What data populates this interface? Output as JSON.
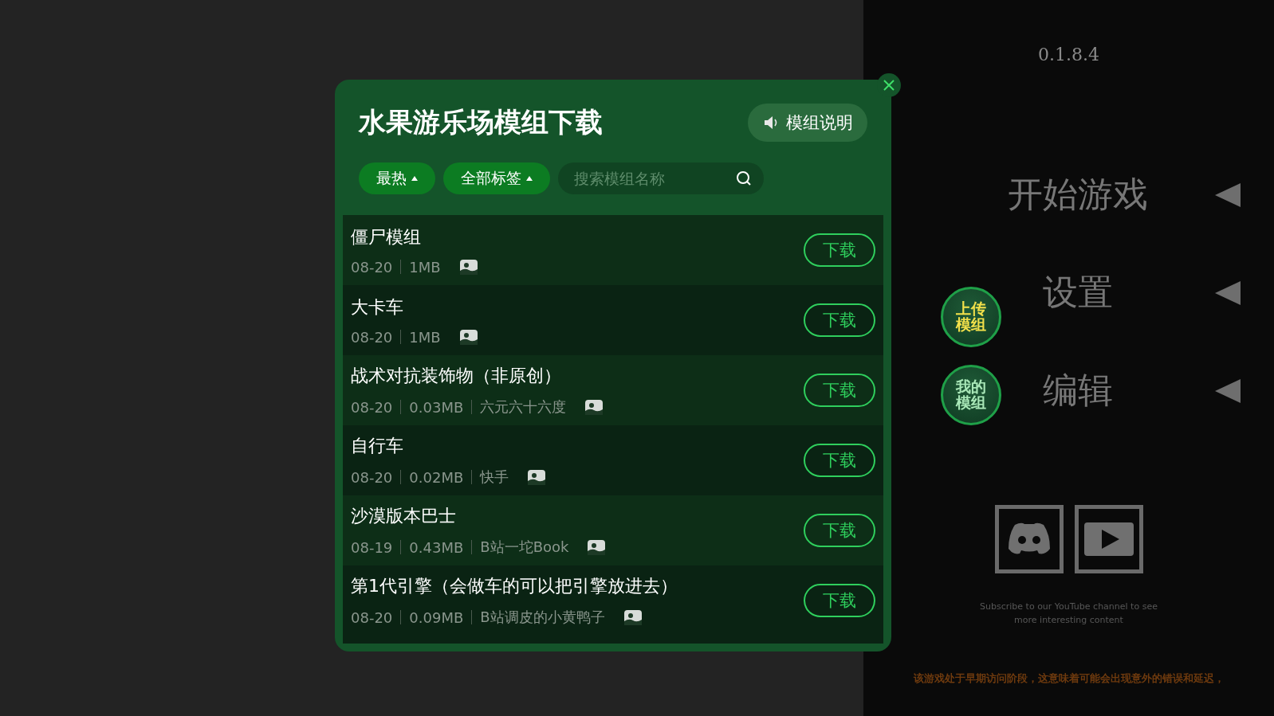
{
  "modal": {
    "title": "水果游乐场模组下载",
    "help_button": "模组说明",
    "filters": [
      {
        "label": "最热"
      },
      {
        "label": "全部标签"
      }
    ],
    "search": {
      "placeholder": "搜索模组名称"
    },
    "mods": [
      {
        "name": "僵尸模组",
        "date": "08-20",
        "size": "1MB",
        "action": "下载"
      },
      {
        "name": "大卡车",
        "date": "08-20",
        "size": "1MB",
        "action": "下载"
      },
      {
        "name": "战术对抗装饰物（非原创）",
        "date": "08-20",
        "size": "0.03MB",
        "author": "六元六十六度",
        "action": "下载"
      },
      {
        "name": "自行车",
        "date": "08-20",
        "size": "0.02MB",
        "author": "快手",
        "action": "下载"
      },
      {
        "name": "沙漠版本巴士",
        "date": "08-19",
        "size": "0.43MB",
        "author": "B站一坨Book",
        "action": "下载"
      },
      {
        "name": "第1代引擎（会做车的可以把引擎放进去）",
        "date": "08-20",
        "size": "0.09MB",
        "author": "B站调皮的小黄鸭子",
        "action": "下载"
      }
    ]
  },
  "main_menu": {
    "version": "0.1.8.4",
    "items": [
      {
        "label": "开始游戏"
      },
      {
        "label": "设置"
      },
      {
        "label": "编辑"
      }
    ]
  },
  "badges": [
    {
      "label": "上传模组"
    },
    {
      "label": "我的模组"
    }
  ],
  "social": [
    {
      "kind": "discord"
    },
    {
      "kind": "video"
    }
  ],
  "subscribe_text": "Subscribe to our YouTube channel to see more interesting content",
  "notice": "该游戏处于早期访问阶段，这意味着可能会出现意外的错误和延迟，"
}
